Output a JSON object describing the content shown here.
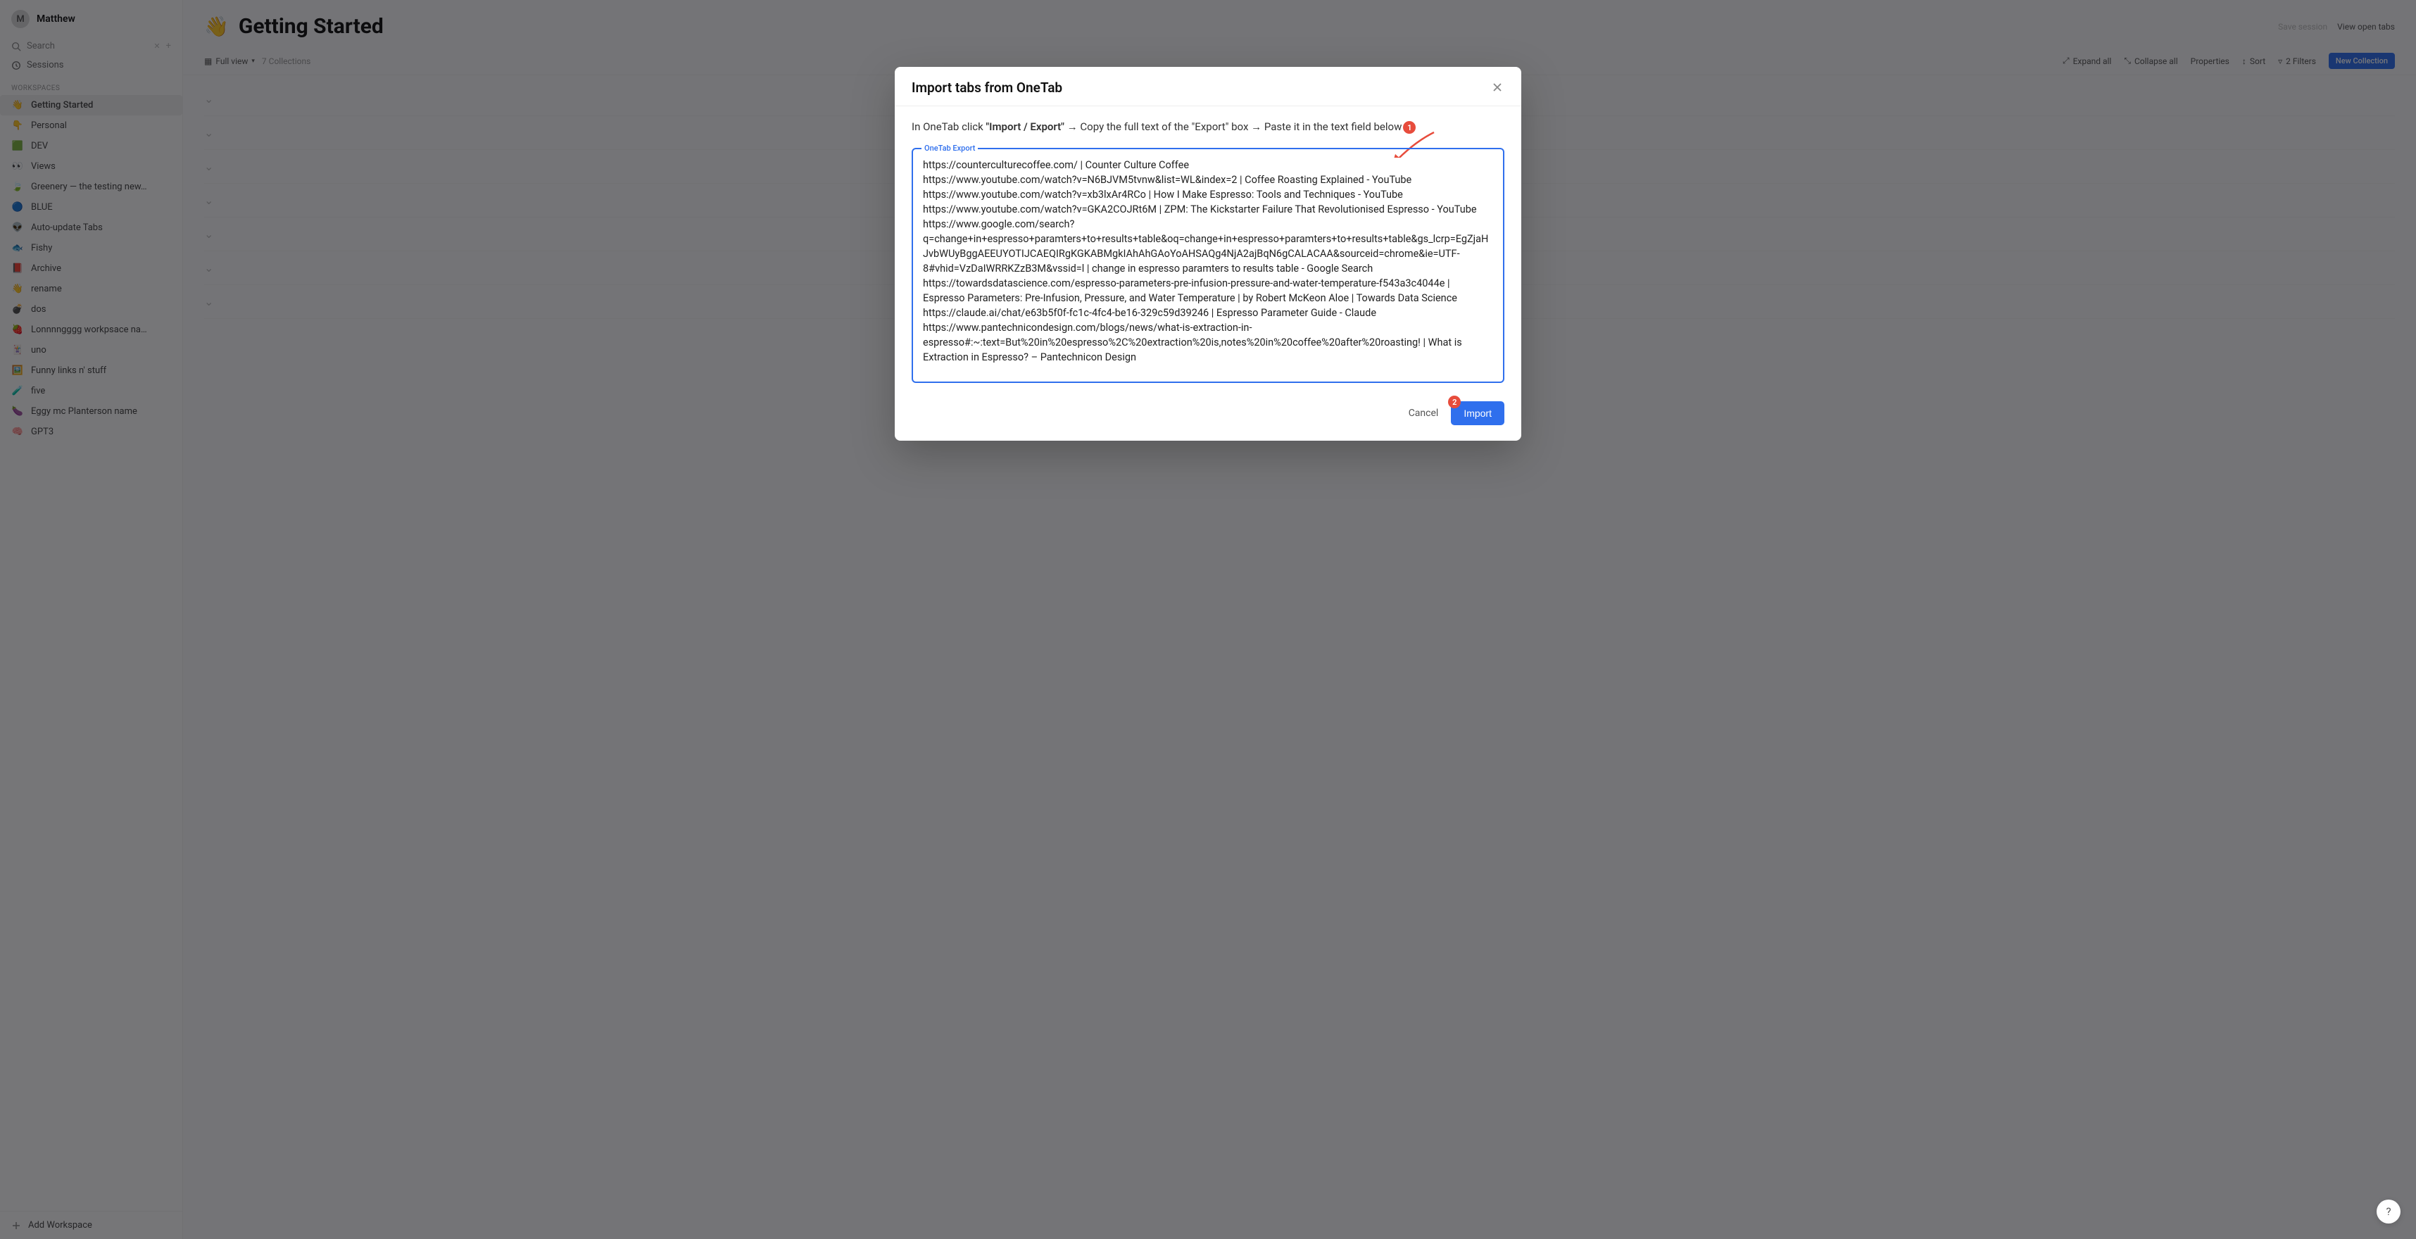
{
  "user": {
    "initial": "M",
    "name": "Matthew"
  },
  "search": {
    "label": "Search"
  },
  "sessions": {
    "label": "Sessions"
  },
  "section_label": "WORKSPACES",
  "workspaces": [
    {
      "emoji": "👋",
      "label": "Getting Started",
      "active": true
    },
    {
      "emoji": "👇",
      "label": "Personal"
    },
    {
      "emoji": "🟩",
      "label": "DEV"
    },
    {
      "emoji": "👀",
      "label": "Views"
    },
    {
      "emoji": "🍃",
      "label": "Greenery — the testing new…"
    },
    {
      "emoji": "🔵",
      "label": "BLUE"
    },
    {
      "emoji": "👽",
      "label": "Auto-update Tabs"
    },
    {
      "emoji": "🐟",
      "label": "Fishy"
    },
    {
      "emoji": "📕",
      "label": "Archive"
    },
    {
      "emoji": "👋",
      "label": "rename"
    },
    {
      "emoji": "💣",
      "label": "dos"
    },
    {
      "emoji": "🍓",
      "label": "Lonnnngggg workpsace na…"
    },
    {
      "emoji": "🃏",
      "label": "uno"
    },
    {
      "emoji": "🖼️",
      "label": "Funny links n' stuff"
    },
    {
      "emoji": "🧪",
      "label": "five"
    },
    {
      "emoji": "🍆",
      "label": "Eggy mc Planterson name"
    },
    {
      "emoji": "🧠",
      "label": "GPT3"
    }
  ],
  "add_workspace": "Add Workspace",
  "page": {
    "emoji": "👋",
    "title": "Getting Started"
  },
  "header_actions": {
    "save_session": "Save session",
    "view_open_tabs": "View open tabs"
  },
  "toolbar": {
    "view_mode": "Full view",
    "count_label": "7 Collections",
    "expand_all": "Expand all",
    "collapse_all": "Collapse all",
    "properties": "Properties",
    "sort": "Sort",
    "filters": "2 Filters",
    "new_collection": "New Collection"
  },
  "modal": {
    "title": "Import tabs from OneTab",
    "instruction_pre": "In OneTab click ",
    "instruction_bold": "\"Import / Export\"",
    "instruction_mid": " → Copy the full text of the \"Export\" box → Paste it in the text field below",
    "badge1": "1",
    "legend": "OneTab Export",
    "textarea_value": "https://counterculturecoffee.com/ | Counter Culture Coffee\nhttps://www.youtube.com/watch?v=N6BJVM5tvnw&list=WL&index=2 | Coffee Roasting Explained - YouTube\nhttps://www.youtube.com/watch?v=xb3lxAr4RCo | How I Make Espresso: Tools and Techniques - YouTube\nhttps://www.youtube.com/watch?v=GKA2COJRt6M | ZPM: The Kickstarter Failure That Revolutionised Espresso - YouTube\nhttps://www.google.com/search?q=change+in+espresso+paramters+to+results+table&oq=change+in+espresso+paramters+to+results+table&gs_lcrp=EgZjaHJvbWUyBggAEEUYOTIJCAEQIRgKGKABMgkIAhAhGAoYoAHSAQg4NjA2ajBqN6gCALACAA&sourceid=chrome&ie=UTF-8#vhid=VzDaIWRRKZzB3M&vssid=l | change in espresso paramters to results table - Google Search\nhttps://towardsdatascience.com/espresso-parameters-pre-infusion-pressure-and-water-temperature-f543a3c4044e | Espresso Parameters: Pre-Infusion, Pressure, and Water Temperature | by Robert McKeon Aloe | Towards Data Science\nhttps://claude.ai/chat/e63b5f0f-fc1c-4fc4-be16-329c59d39246 | Espresso Parameter Guide - Claude\nhttps://www.pantechnicondesign.com/blogs/news/what-is-extraction-in-espresso#:~:text=But%20in%20espresso%2C%20extraction%20is,notes%20in%20coffee%20after%20roasting! | What is Extraction in Espresso? – Pantechnicon Design",
    "cancel": "Cancel",
    "import": "Import",
    "badge2": "2"
  },
  "help": "?"
}
